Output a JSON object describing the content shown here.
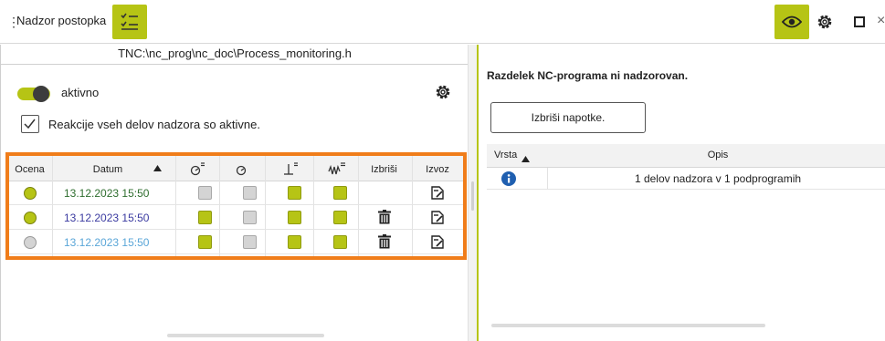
{
  "window": {
    "title": "Nadzor postopka",
    "drag_handle": "⋮",
    "close_glyph": "×"
  },
  "left": {
    "path": "TNC:\\nc_prog\\nc_doc\\Process_monitoring.h",
    "toggle": {
      "label": "aktivno",
      "on": true
    },
    "checkbox": {
      "label": "Reakcije vseh delov nadzora so aktivne.",
      "checked": true
    },
    "table": {
      "headers": {
        "rating": "Ocena",
        "date": "Datum",
        "delete": "Izbriši",
        "export": "Izvoz"
      },
      "rows": [
        {
          "date": "13.12.2023 15:50",
          "date_color": "#2f6e2f",
          "dot": "#b6c415",
          "c1": false,
          "c2": false,
          "c3": true,
          "c4": true,
          "deletable": false
        },
        {
          "date": "13.12.2023 15:50",
          "date_color": "#3a3aa0",
          "dot": "#b6c415",
          "c1": true,
          "c2": false,
          "c3": true,
          "c4": true,
          "deletable": true
        },
        {
          "date": "13.12.2023 15:50",
          "date_color": "#5aa6d8",
          "dot": "#d4d4d4",
          "c1": true,
          "c2": false,
          "c3": true,
          "c4": true,
          "deletable": true
        }
      ]
    }
  },
  "right": {
    "message": "Razdelek NC-programa ni nadzorovan.",
    "clear_button": "Izbriši napotke.",
    "table": {
      "headers": {
        "type": "Vrsta",
        "desc": "Opis"
      },
      "rows": [
        {
          "type": "info",
          "desc": "1 delov nadzora v 1 podprogramih"
        }
      ]
    }
  },
  "colors": {
    "accent": "#b6c415",
    "highlight_frame": "#f07d1a"
  }
}
